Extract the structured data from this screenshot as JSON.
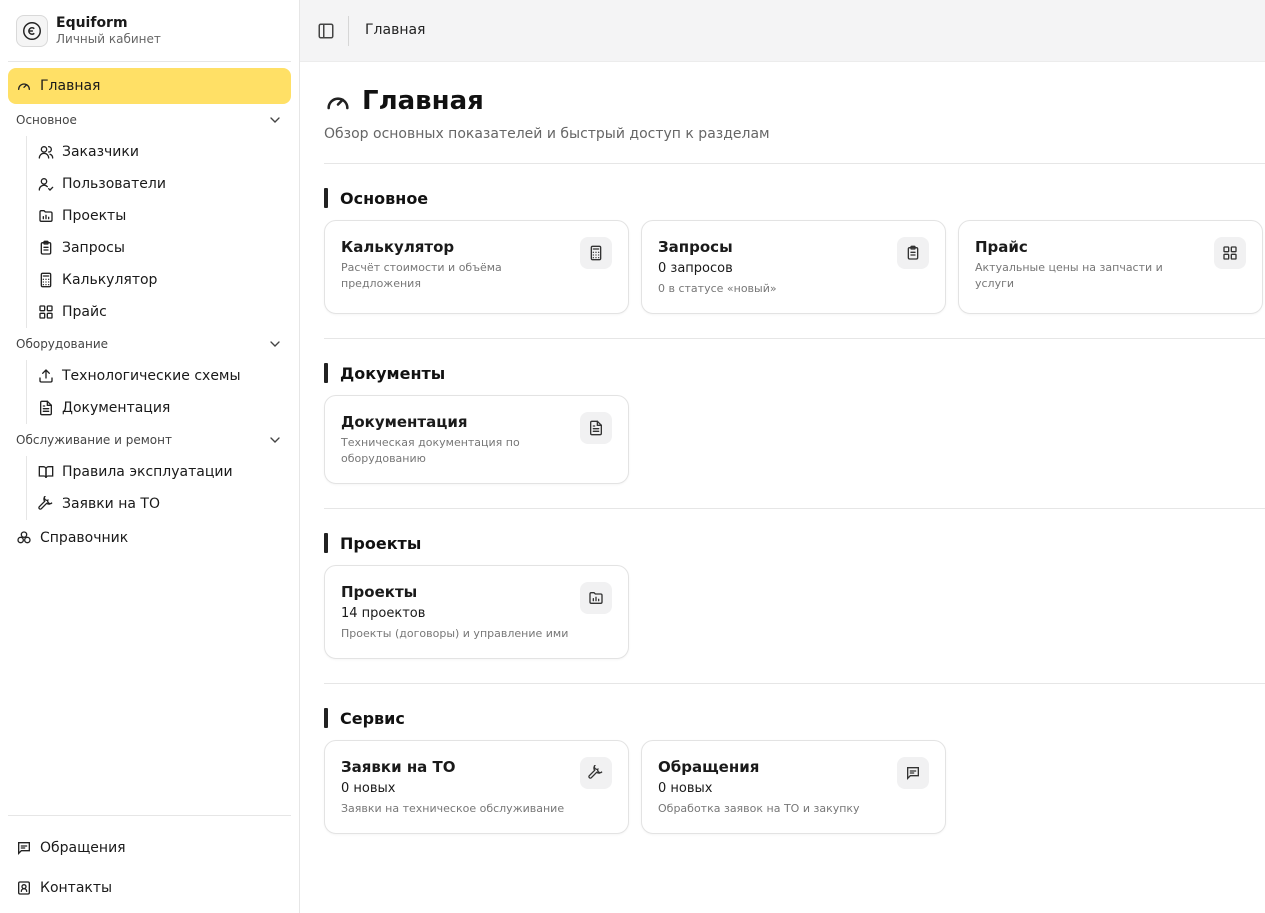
{
  "brand": {
    "name": "Equiform",
    "subtitle": "Личный кабинет"
  },
  "sidebar": {
    "active": {
      "label": "Главная",
      "icon": "gauge-icon"
    },
    "groups": [
      {
        "title": "Основное",
        "items": [
          {
            "label": "Заказчики",
            "icon": "users-icon"
          },
          {
            "label": "Пользователи",
            "icon": "user-check-icon"
          },
          {
            "label": "Проекты",
            "icon": "folder-chart-icon"
          },
          {
            "label": "Запросы",
            "icon": "clipboard-icon"
          },
          {
            "label": "Калькулятор",
            "icon": "calculator-icon"
          },
          {
            "label": "Прайс",
            "icon": "grid-icon"
          }
        ]
      },
      {
        "title": "Оборудование",
        "items": [
          {
            "label": "Технологические схемы",
            "icon": "upload-icon"
          },
          {
            "label": "Документация",
            "icon": "file-text-icon"
          }
        ]
      },
      {
        "title": "Обслуживание и ремонт",
        "items": [
          {
            "label": "Правила эксплуатации",
            "icon": "book-icon"
          },
          {
            "label": "Заявки на ТО",
            "icon": "wrench-icon"
          }
        ]
      }
    ],
    "reference": {
      "label": "Справочник",
      "icon": "boxes-icon"
    },
    "footer": [
      {
        "label": "Обращения",
        "icon": "message-icon"
      },
      {
        "label": "Контакты",
        "icon": "contact-icon"
      }
    ]
  },
  "topbar": {
    "breadcrumb": "Главная"
  },
  "page": {
    "title": "Главная",
    "subtitle": "Обзор основных показателей и быстрый доступ к разделам"
  },
  "sections": [
    {
      "title": "Основное",
      "cards": [
        {
          "title": "Калькулятор",
          "stat": "",
          "desc": "Расчёт стоимости и объёма предложения",
          "icon": "calculator-icon"
        },
        {
          "title": "Запросы",
          "stat": "0 запросов",
          "desc": "0 в статусе «новый»",
          "icon": "clipboard-icon"
        },
        {
          "title": "Прайс",
          "stat": "",
          "desc": "Актуальные цены на запчасти и услуги",
          "icon": "grid-icon"
        }
      ]
    },
    {
      "title": "Документы",
      "cards": [
        {
          "title": "Документация",
          "stat": "",
          "desc": "Техническая документация по оборудованию",
          "icon": "file-text-icon"
        }
      ]
    },
    {
      "title": "Проекты",
      "cards": [
        {
          "title": "Проекты",
          "stat": "14 проектов",
          "desc": "Проекты (договоры) и управление ими",
          "icon": "folder-chart-icon"
        }
      ]
    },
    {
      "title": "Сервис",
      "cards": [
        {
          "title": "Заявки на ТО",
          "stat": "0 новых",
          "desc": "Заявки на техническое обслуживание",
          "icon": "wrench-icon"
        },
        {
          "title": "Обращения",
          "stat": "0 новых",
          "desc": "Обработка заявок на ТО и закупку",
          "icon": "message-icon"
        }
      ]
    }
  ],
  "colors": {
    "accent": "#ffe066",
    "text": "#1a1a1a",
    "muted": "#777777",
    "topbar": "#f4f4f5"
  }
}
